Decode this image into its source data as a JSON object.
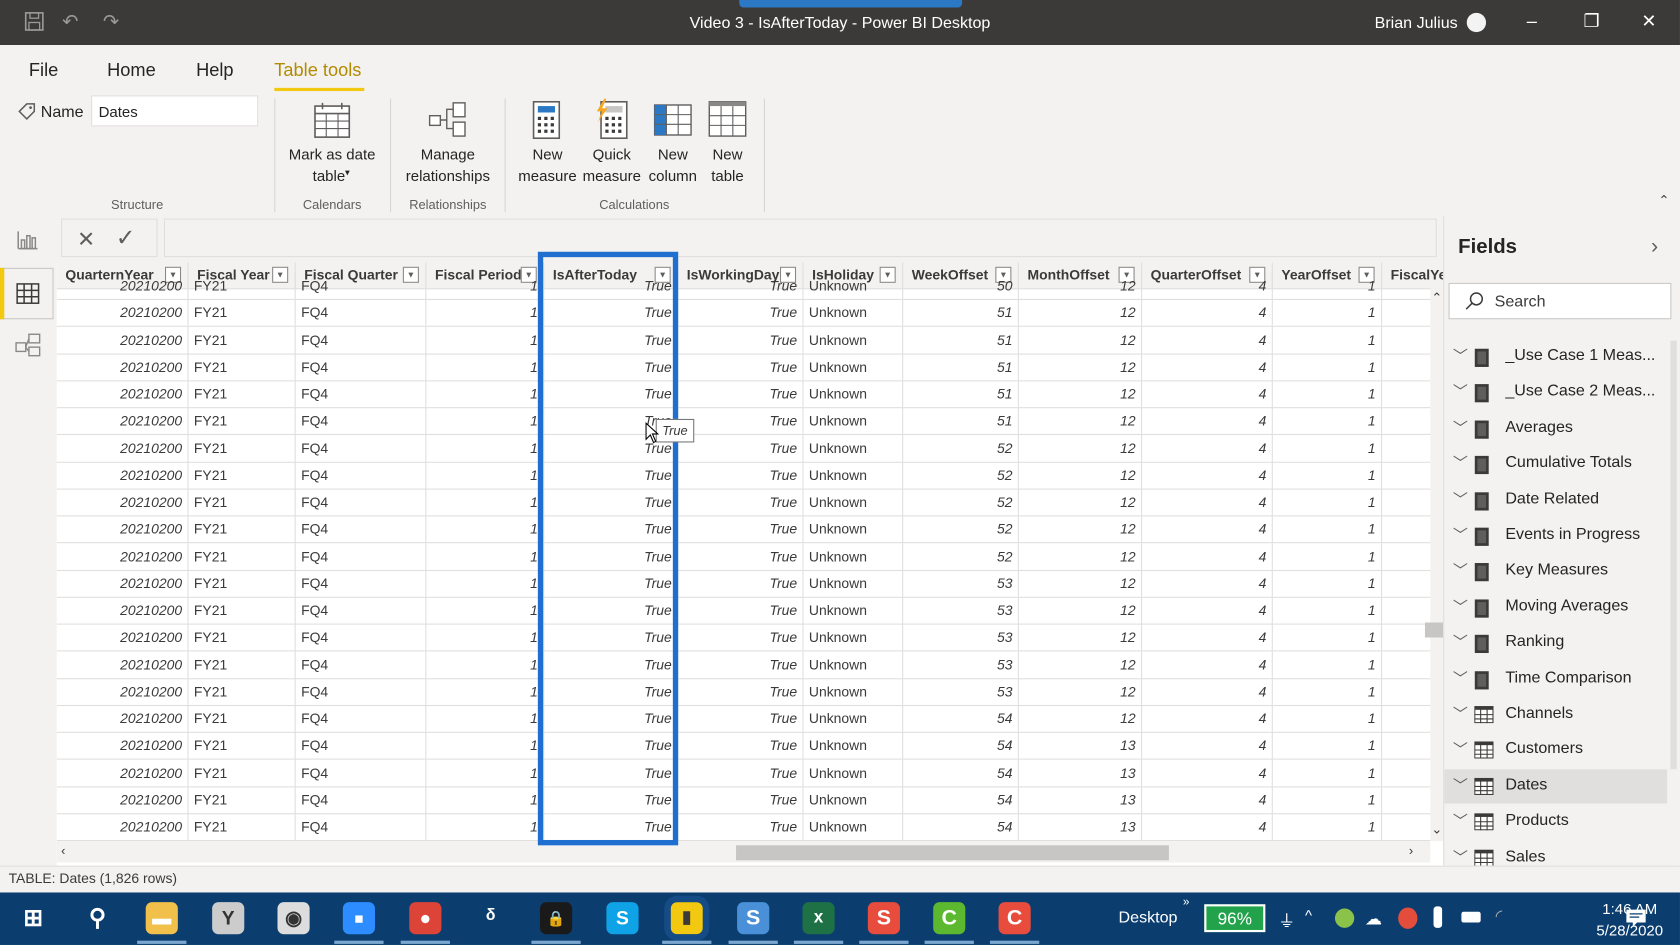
{
  "titlebar": {
    "title": "Video 3 - IsAfterToday - Power BI Desktop",
    "user": "Brian Julius",
    "minimize": "–",
    "restore": "❐",
    "close": "✕"
  },
  "ribbon": {
    "tabs": [
      {
        "label": "File"
      },
      {
        "label": "Home"
      },
      {
        "label": "Help"
      },
      {
        "label": "Table tools",
        "active": true
      }
    ],
    "name_label": "Name",
    "name_value": "Dates",
    "buttons": {
      "mark_date_line1": "Mark as date",
      "mark_date_line2": "table",
      "manage_rel_line1": "Manage",
      "manage_rel_line2": "relationships",
      "new_measure_line1": "New",
      "new_measure_line2": "measure",
      "quick_measure_line1": "Quick",
      "quick_measure_line2": "measure",
      "new_column_line1": "New",
      "new_column_line2": "column",
      "new_table_line1": "New",
      "new_table_line2": "table"
    },
    "groups": {
      "structure": "Structure",
      "calendars": "Calendars",
      "relationships": "Relationships",
      "calculations": "Calculations"
    }
  },
  "formula_bar": {
    "cancel": "✕",
    "commit": "✓"
  },
  "grid": {
    "columns": [
      {
        "label": "QuarternYear"
      },
      {
        "label": "Fiscal Year"
      },
      {
        "label": "Fiscal Quarter"
      },
      {
        "label": "Fiscal Period"
      },
      {
        "label": "IsAfterToday"
      },
      {
        "label": "IsWorkingDay"
      },
      {
        "label": "IsHoliday"
      },
      {
        "label": "WeekOffset"
      },
      {
        "label": "MonthOffset"
      },
      {
        "label": "QuarterOffset"
      },
      {
        "label": "YearOffset"
      },
      {
        "label": "FiscalYe"
      }
    ],
    "rows": [
      [
        "20210200",
        "FY21",
        "FQ4",
        "1",
        "True",
        "True",
        "Unknown",
        "50",
        "12",
        "4",
        "1",
        ""
      ],
      [
        "20210200",
        "FY21",
        "FQ4",
        "1",
        "True",
        "True",
        "Unknown",
        "51",
        "12",
        "4",
        "1",
        ""
      ],
      [
        "20210200",
        "FY21",
        "FQ4",
        "1",
        "True",
        "True",
        "Unknown",
        "51",
        "12",
        "4",
        "1",
        ""
      ],
      [
        "20210200",
        "FY21",
        "FQ4",
        "1",
        "True",
        "True",
        "Unknown",
        "51",
        "12",
        "4",
        "1",
        ""
      ],
      [
        "20210200",
        "FY21",
        "FQ4",
        "1",
        "True",
        "True",
        "Unknown",
        "51",
        "12",
        "4",
        "1",
        ""
      ],
      [
        "20210200",
        "FY21",
        "FQ4",
        "1",
        "True",
        "True",
        "Unknown",
        "51",
        "12",
        "4",
        "1",
        ""
      ],
      [
        "20210200",
        "FY21",
        "FQ4",
        "1",
        "True",
        "True",
        "Unknown",
        "52",
        "12",
        "4",
        "1",
        ""
      ],
      [
        "20210200",
        "FY21",
        "FQ4",
        "1",
        "True",
        "True",
        "Unknown",
        "52",
        "12",
        "4",
        "1",
        ""
      ],
      [
        "20210200",
        "FY21",
        "FQ4",
        "1",
        "True",
        "True",
        "Unknown",
        "52",
        "12",
        "4",
        "1",
        ""
      ],
      [
        "20210200",
        "FY21",
        "FQ4",
        "1",
        "True",
        "True",
        "Unknown",
        "52",
        "12",
        "4",
        "1",
        ""
      ],
      [
        "20210200",
        "FY21",
        "FQ4",
        "1",
        "True",
        "True",
        "Unknown",
        "52",
        "12",
        "4",
        "1",
        ""
      ],
      [
        "20210200",
        "FY21",
        "FQ4",
        "1",
        "True",
        "True",
        "Unknown",
        "53",
        "12",
        "4",
        "1",
        ""
      ],
      [
        "20210200",
        "FY21",
        "FQ4",
        "1",
        "True",
        "True",
        "Unknown",
        "53",
        "12",
        "4",
        "1",
        ""
      ],
      [
        "20210200",
        "FY21",
        "FQ4",
        "1",
        "True",
        "True",
        "Unknown",
        "53",
        "12",
        "4",
        "1",
        ""
      ],
      [
        "20210200",
        "FY21",
        "FQ4",
        "1",
        "True",
        "True",
        "Unknown",
        "53",
        "12",
        "4",
        "1",
        ""
      ],
      [
        "20210200",
        "FY21",
        "FQ4",
        "1",
        "True",
        "True",
        "Unknown",
        "53",
        "12",
        "4",
        "1",
        ""
      ],
      [
        "20210200",
        "FY21",
        "FQ4",
        "1",
        "True",
        "True",
        "Unknown",
        "54",
        "12",
        "4",
        "1",
        ""
      ],
      [
        "20210200",
        "FY21",
        "FQ4",
        "1",
        "True",
        "True",
        "Unknown",
        "54",
        "13",
        "4",
        "1",
        ""
      ],
      [
        "20210200",
        "FY21",
        "FQ4",
        "1",
        "True",
        "True",
        "Unknown",
        "54",
        "13",
        "4",
        "1",
        ""
      ],
      [
        "20210200",
        "FY21",
        "FQ4",
        "1",
        "True",
        "True",
        "Unknown",
        "54",
        "13",
        "4",
        "1",
        ""
      ],
      [
        "20210200",
        "FY21",
        "FQ4",
        "1",
        "True",
        "True",
        "Unknown",
        "54",
        "13",
        "4",
        "1",
        ""
      ]
    ],
    "tooltip": "True",
    "highlight_color": "#1f6fd1"
  },
  "fields": {
    "title": "Fields",
    "search_placeholder": "Search",
    "items": [
      {
        "label": "_Use Case 1 Meas...",
        "type": "measure"
      },
      {
        "label": "_Use Case 2 Meas...",
        "type": "measure"
      },
      {
        "label": "Averages",
        "type": "measure"
      },
      {
        "label": "Cumulative Totals",
        "type": "measure"
      },
      {
        "label": "Date Related",
        "type": "measure"
      },
      {
        "label": "Events in Progress",
        "type": "measure"
      },
      {
        "label": "Key Measures",
        "type": "measure"
      },
      {
        "label": "Moving Averages",
        "type": "measure"
      },
      {
        "label": "Ranking",
        "type": "measure"
      },
      {
        "label": "Time Comparison",
        "type": "measure"
      },
      {
        "label": "Channels",
        "type": "table"
      },
      {
        "label": "Customers",
        "type": "table"
      },
      {
        "label": "Dates",
        "type": "table",
        "selected": true
      },
      {
        "label": "Products",
        "type": "table"
      },
      {
        "label": "Sales",
        "type": "table"
      }
    ]
  },
  "status": {
    "text": "TABLE: Dates (1,826 rows)"
  },
  "taskbar": {
    "apps": [
      "start",
      "search",
      "file-explorer",
      "clock-app",
      "media-player",
      "zoom",
      "chrome",
      "dragon",
      "keepass",
      "skype",
      "power-bi",
      "snagit",
      "excel",
      "snagit-editor",
      "camtasia",
      "camtasia-recorder"
    ],
    "desktop_label": "Desktop",
    "battery": "96%",
    "time": "1:46 AM",
    "date": "5/28/2020"
  },
  "colors": {
    "accent": "#f2c811",
    "highlight": "#1f6fd1",
    "taskbar": "#0b3e6f"
  }
}
